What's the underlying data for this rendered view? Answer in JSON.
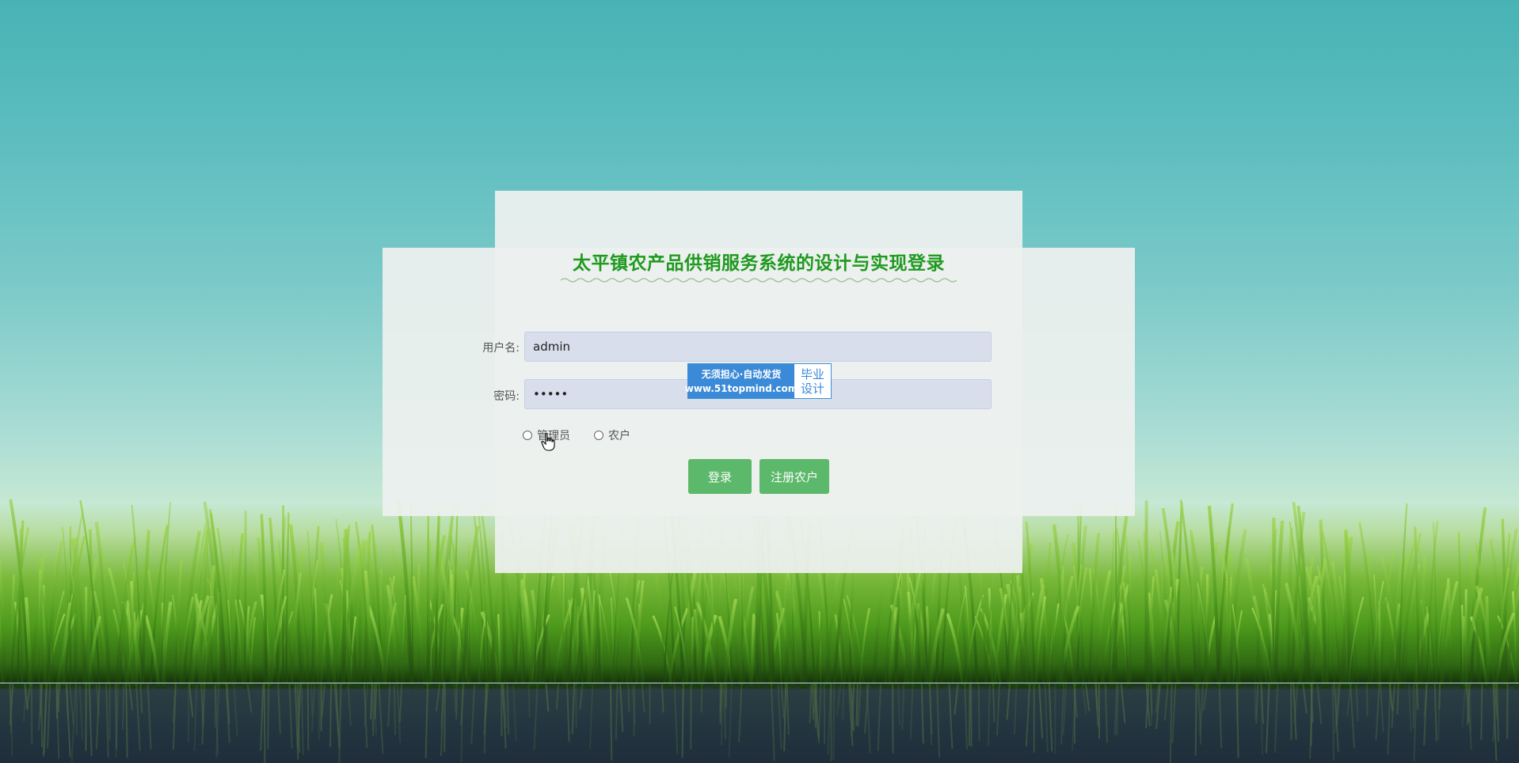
{
  "page": {
    "title": "太平镇农产品供销服务系统的设计与实现登录"
  },
  "form": {
    "username_label": "用户名:",
    "username_value": "admin",
    "password_label": "密码:",
    "password_value": "•••••",
    "roles": [
      {
        "label": "管理员"
      },
      {
        "label": "农户"
      }
    ],
    "login_button": "登录",
    "register_button": "注册农户"
  },
  "watermark": {
    "line1": "无须担心·自动发货",
    "line2": "www.51topmind.com",
    "right_line1": "毕业",
    "right_line2": "设计"
  },
  "colors": {
    "title": "#1f9a1f",
    "button": "#5cb86a",
    "input_bg": "#d8deeb",
    "watermark_blue": "#3a8ad8"
  }
}
